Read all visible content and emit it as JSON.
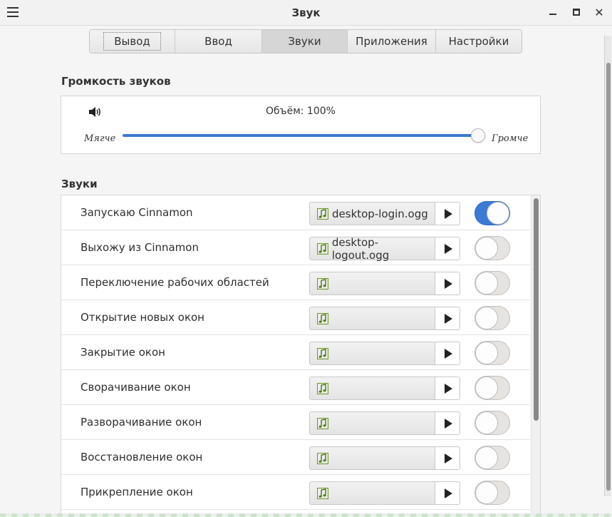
{
  "window": {
    "title": "Звук"
  },
  "tabs": [
    {
      "label": "Вывод"
    },
    {
      "label": "Ввод"
    },
    {
      "label": "Звуки"
    },
    {
      "label": "Приложения"
    },
    {
      "label": "Настройки"
    }
  ],
  "volume": {
    "section_title": "Громкость звуков",
    "label": "Объём: 100%",
    "level": 1.0,
    "softer": "Мягче",
    "louder": "Громче"
  },
  "sounds": {
    "section_title": "Звуки",
    "items": [
      {
        "label": "Запускаю Cinnamon",
        "file": "desktop-login.ogg",
        "enabled": true
      },
      {
        "label": "Выхожу из Cinnamon",
        "file": "desktop-logout.ogg",
        "enabled": false
      },
      {
        "label": "Переключение рабочих областей",
        "file": "",
        "enabled": false
      },
      {
        "label": "Открытие новых окон",
        "file": "",
        "enabled": false
      },
      {
        "label": "Закрытие окон",
        "file": "",
        "enabled": false
      },
      {
        "label": "Сворачивание окон",
        "file": "",
        "enabled": false
      },
      {
        "label": "Разворачивание окон",
        "file": "",
        "enabled": false
      },
      {
        "label": "Восстановление окон",
        "file": "",
        "enabled": false
      },
      {
        "label": "Прикрепление окон",
        "file": "",
        "enabled": false
      }
    ]
  },
  "icons": {
    "speaker": "speaker-icon",
    "note": "music-note-icon",
    "play": "play-icon"
  },
  "colors": {
    "accent": "#3c78d0",
    "note": "#6a9a1f"
  }
}
